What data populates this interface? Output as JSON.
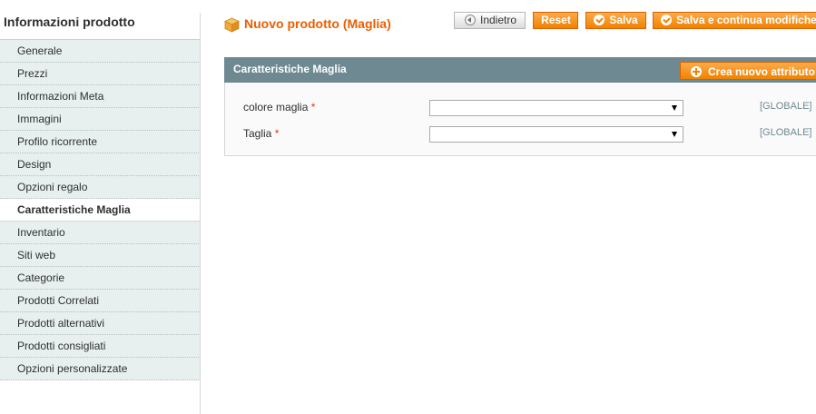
{
  "sidebar": {
    "title": "Informazioni prodotto",
    "tabs": [
      {
        "label": "Generale"
      },
      {
        "label": "Prezzi"
      },
      {
        "label": "Informazioni Meta"
      },
      {
        "label": "Immagini"
      },
      {
        "label": "Profilo ricorrente"
      },
      {
        "label": "Design"
      },
      {
        "label": "Opzioni regalo"
      },
      {
        "label": "Caratteristiche Maglia",
        "active": true
      },
      {
        "label": "Inventario"
      },
      {
        "label": "Siti web"
      },
      {
        "label": "Categorie"
      },
      {
        "label": "Prodotti Correlati"
      },
      {
        "label": "Prodotti alternativi"
      },
      {
        "label": "Prodotti consigliati"
      },
      {
        "label": "Opzioni personalizzate"
      }
    ]
  },
  "header": {
    "title": "Nuovo prodotto (Maglia)",
    "title_icon": "package-icon",
    "buttons": {
      "back": "Indietro",
      "reset": "Reset",
      "save": "Salva",
      "save_continue": "Salva e continua modifiche"
    }
  },
  "fieldset": {
    "title": "Caratteristiche Maglia",
    "new_attribute_button": "Crea nuovo attributo",
    "fields": [
      {
        "label": "colore maglia",
        "required_mark": "*",
        "value": "",
        "scope": "[GLOBALE]"
      },
      {
        "label": "Taglia",
        "required_mark": "*",
        "value": "",
        "scope": "[GLOBALE]"
      }
    ]
  },
  "colors": {
    "accent": "#eb5e00",
    "button": "#f18200",
    "panel_header": "#6f8992",
    "tab_background": "#e7efef"
  }
}
